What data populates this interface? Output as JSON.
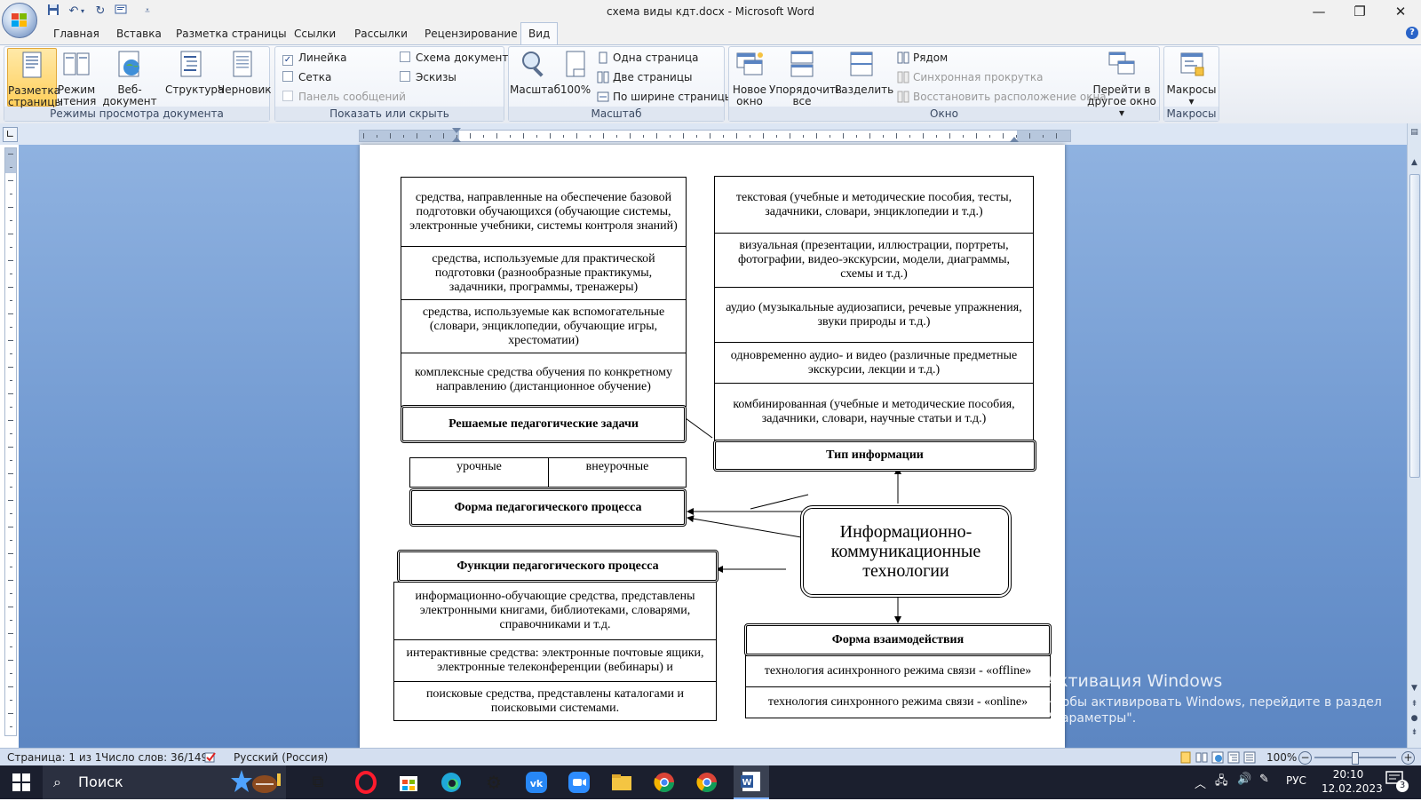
{
  "window": {
    "title": "схема виды кдт.docx - Microsoft Word",
    "minimize": "—",
    "restore": "❐",
    "close": "✕"
  },
  "tabs": [
    "Главная",
    "Вставка",
    "Разметка страницы",
    "Ссылки",
    "Рассылки",
    "Рецензирование",
    "Вид"
  ],
  "active_tab": "Вид",
  "ribbon": {
    "views": {
      "label": "Режимы просмотра документа",
      "buttons": [
        {
          "line1": "Разметка",
          "line2": "страницы"
        },
        {
          "line1": "Режим",
          "line2": "чтения"
        },
        {
          "line1": "Веб-документ",
          "line2": ""
        },
        {
          "line1": "Структура",
          "line2": ""
        },
        {
          "line1": "Черновик",
          "line2": ""
        }
      ]
    },
    "show_hide": {
      "label": "Показать или скрыть",
      "items": {
        "ruler": "Линейка",
        "grid": "Сетка",
        "message_bar": "Панель сообщений",
        "doc_map": "Схема документа",
        "thumbnails": "Эскизы"
      }
    },
    "zoom": {
      "label": "Масштаб",
      "zoom_btn": "Масштаб",
      "percent_btn": "100%",
      "one_page": "Одна страница",
      "two_pages": "Две страницы",
      "page_width": "По ширине страницы"
    },
    "window": {
      "label": "Окно",
      "new_window": {
        "line1": "Новое",
        "line2": "окно"
      },
      "arrange_all": {
        "line1": "Упорядочить",
        "line2": "все"
      },
      "split": {
        "line1": "Разделить",
        "line2": ""
      },
      "side_by_side": "Рядом",
      "sync_scroll": "Синхронная прокрутка",
      "reset_position": "Восстановить расположение окна",
      "switch_windows": {
        "line1": "Перейти в",
        "line2": "другое окно ▾"
      }
    },
    "macros": {
      "label": "Макросы",
      "button": "Макросы",
      "arrow": "▾"
    }
  },
  "diagram": {
    "center": "Информационно-коммуникационные технологии",
    "ped_tasks": {
      "header": "Решаемые педагогические задачи",
      "items": [
        "средства, направленные на обеспечение базовой подготовки обучающихся (обучающие системы, электронные учебники, системы контроля знаний)",
        "средства, используемые для практической подготовки (разнообразные практикумы, задачники, программы, тренажеры)",
        "средства, используемые как вспомогательные (словари, энциклопедии, обучающие игры, хрестоматии)",
        "комплексные средства обучения по конкретному направлению (дистанционное обучение)"
      ]
    },
    "info_type": {
      "header": "Тип информации",
      "items": [
        "текстовая (учебные и методические пособия, тесты, задачники, словари, энциклопедии и т.д.)",
        "визуальная (презентации, иллюстрации, портреты, фотографии, видео-экскурсии, модели, диаграммы, схемы и т.д.)",
        "аудио (музыкальные аудиозаписи, речевые упражнения, звуки природы и т.д.)",
        "одновременно аудио- и видео (различные предметные экскурсии, лекции и т.д.)",
        "комбинированная (учебные и методические пособия, задачники, словари, научные статьи и т.д.)"
      ]
    },
    "ped_form": {
      "header": "Форма педагогического процесса",
      "items": [
        "урочные",
        "внеурочные"
      ]
    },
    "ped_functions": {
      "header": "Функции педагогического  процесса",
      "items": [
        "информационно-обучающие средства, представлены электронными книгами, библиотеками, словарями, справочниками и т.д.",
        "интерактивные средства: электронные почтовые ящики, электронные телеконференции (вебинары) и",
        "поисковые средства, представлены каталогами и поисковыми системами."
      ]
    },
    "interaction_form": {
      "header": "Форма взаимодействия",
      "items": [
        "технология асинхронного режима связи - «offline»",
        "технология синхронного режима связи - «online»"
      ]
    }
  },
  "activation": {
    "title": "Активация Windows",
    "text": "Чтобы активировать Windows, перейдите в раздел \"Параметры\"."
  },
  "status": {
    "page": "Страница: 1 из 1",
    "words": "Число слов: 36/149",
    "language": "Русский (Россия)",
    "zoom": "100%"
  },
  "taskbar": {
    "search": "Поиск",
    "lang": "РУС",
    "time": "20:10",
    "date": "12.02.2023",
    "notifications": "3"
  },
  "colors": {
    "accent": "#2a64c8",
    "workspace": "#6d96cf",
    "taskbar": "#1b1f2e"
  }
}
